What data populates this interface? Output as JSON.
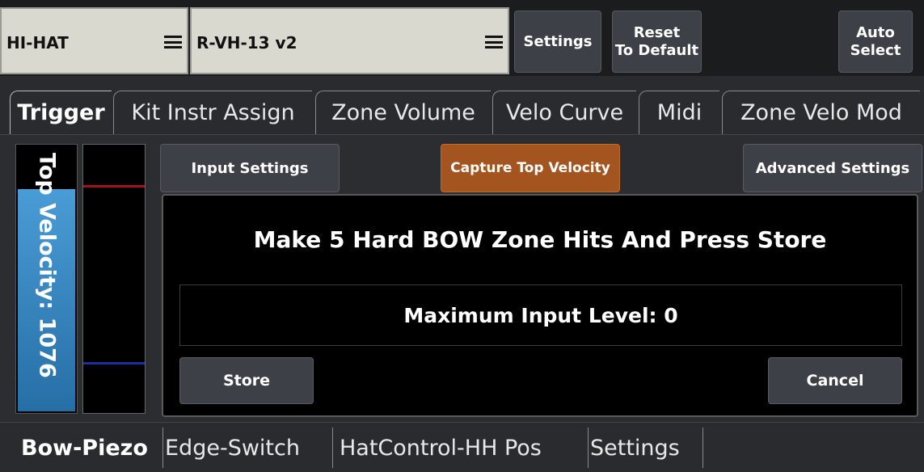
{
  "header": {
    "instrument_select": "HI-HAT",
    "kit_select": "R-VH-13 v2",
    "settings_label": "Settings",
    "reset_label": "Reset\nTo Default",
    "auto_select_label": "Auto\nSelect"
  },
  "main_tabs": [
    {
      "label": "Trigger",
      "active": true
    },
    {
      "label": "Kit Instr Assign",
      "active": false
    },
    {
      "label": "Zone Volume",
      "active": false
    },
    {
      "label": "Velo Curve",
      "active": false
    },
    {
      "label": "Midi",
      "active": false
    },
    {
      "label": "Zone Velo Mod",
      "active": false
    }
  ],
  "meter": {
    "label": "Top Velocity: 1076",
    "fill_fraction": 0.84,
    "colors": {
      "fill": "#3d8ccc",
      "red_marker": "#a0131c",
      "blue_marker": "#1a2ea0"
    }
  },
  "sub_buttons": {
    "input_settings": "Input Settings",
    "capture_top_velocity": "Capture Top Velocity",
    "advanced_settings": "Advanced Settings"
  },
  "panel": {
    "instruction": "Make 5 Hard BOW Zone Hits And Press Store",
    "max_level": "Maximum Input Level: 0",
    "store_label": "Store",
    "cancel_label": "Cancel"
  },
  "bottom_tabs": [
    {
      "label": "Bow-Piezo",
      "active": true
    },
    {
      "label": "Edge-Switch",
      "active": false
    },
    {
      "label": "HatControl-HH Pos",
      "active": false
    },
    {
      "label": "Settings",
      "active": false
    }
  ],
  "colors": {
    "accent_orange": "#a4541e",
    "button_gray": "#3e4047",
    "selector_bg": "#d9d9cf"
  }
}
